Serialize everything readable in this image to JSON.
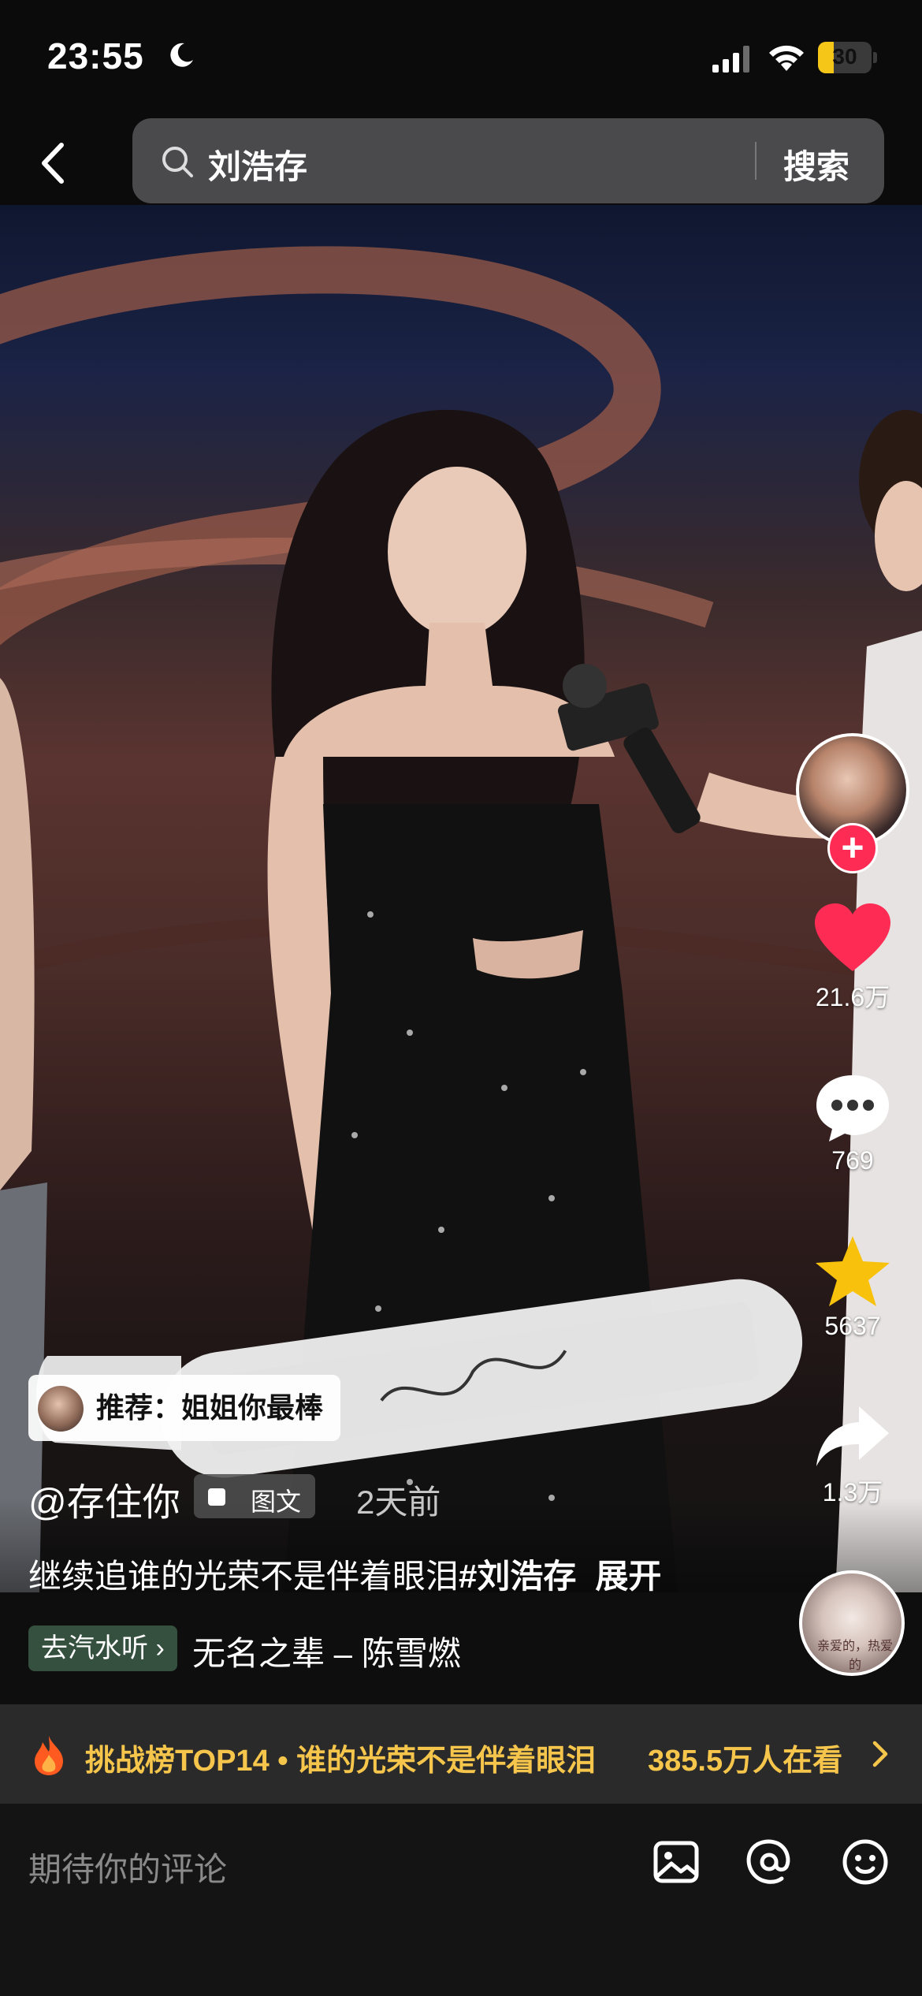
{
  "status_bar": {
    "time": "23:55",
    "battery": "30",
    "battery_level": 0.3
  },
  "search": {
    "query": "刘浩存",
    "button": "搜索"
  },
  "rail": {
    "likes": "21.6万",
    "comments": "769",
    "favorites": "5637",
    "shares": "1.3万",
    "follow_symbol": "+"
  },
  "caption": {
    "recommendation": "推荐：姐姐你最棒",
    "author": "@存住你",
    "type_tag": "图文",
    "time_ago": "2天前",
    "description": "继续追谁的光荣不是伴着眼泪",
    "hashtag": "#刘浩存",
    "expand": "展开"
  },
  "music": {
    "chip": "去汽水听 ›",
    "song": "无名之辈 – 陈雪燃",
    "disc_text": "亲爱的，热爱的"
  },
  "challenge": {
    "text": "挑战榜TOP14 • 谁的光荣不是伴着眼泪",
    "watching": "385.5万人在看"
  },
  "comment_bar": {
    "placeholder": "期待你的评论"
  },
  "colors": {
    "accent_red": "#fe2c55",
    "like_red": "#fe2c55",
    "star_yellow": "#f8c20c",
    "challenge_yellow": "#f6c54b"
  }
}
